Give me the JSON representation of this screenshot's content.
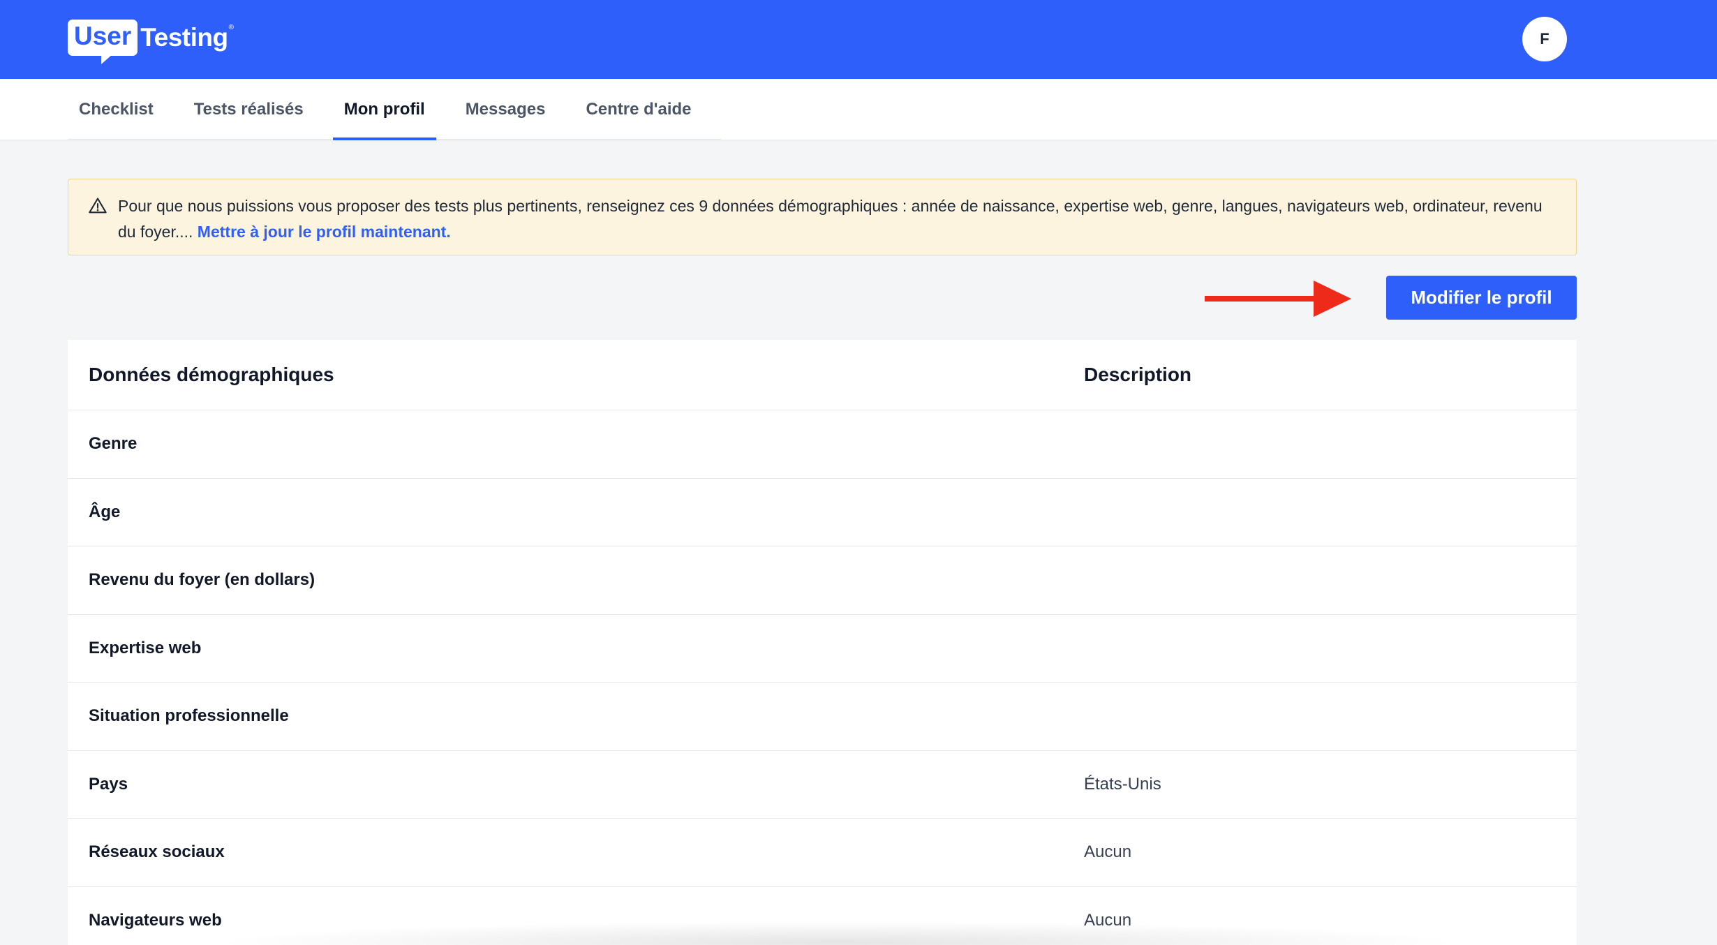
{
  "header": {
    "logo_user": "User",
    "logo_testing": "Testing",
    "logo_reg": "®",
    "avatar_initial": "F"
  },
  "tabs": [
    {
      "label": "Checklist",
      "active": false
    },
    {
      "label": "Tests réalisés",
      "active": false
    },
    {
      "label": "Mon profil",
      "active": true
    },
    {
      "label": "Messages",
      "active": false
    },
    {
      "label": "Centre d'aide",
      "active": false
    }
  ],
  "alert": {
    "icon": "warning-icon",
    "text": "Pour que nous puissions vous proposer des tests plus pertinents, renseignez ces 9 données démographiques : année de naissance, expertise web, genre, langues, navigateurs web, ordinateur, revenu du foyer.... ",
    "link": "Mettre à jour le profil maintenant."
  },
  "actions": {
    "edit_profile_label": "Modifier le profil"
  },
  "table": {
    "headers": {
      "label": "Données démographiques",
      "description": "Description"
    },
    "rows": [
      {
        "label": "Genre",
        "value": ""
      },
      {
        "label": "Âge",
        "value": ""
      },
      {
        "label": "Revenu du foyer (en dollars)",
        "value": ""
      },
      {
        "label": "Expertise web",
        "value": ""
      },
      {
        "label": "Situation professionnelle",
        "value": ""
      },
      {
        "label": "Pays",
        "value": "États-Unis"
      },
      {
        "label": "Réseaux sociaux",
        "value": "Aucun"
      },
      {
        "label": "Navigateurs web",
        "value": "Aucun"
      }
    ]
  },
  "colors": {
    "brand": "#2f5ffb",
    "alert_bg": "#fdf4df",
    "alert_border": "#f1d48f",
    "annotation_arrow": "#ee2b1b"
  }
}
